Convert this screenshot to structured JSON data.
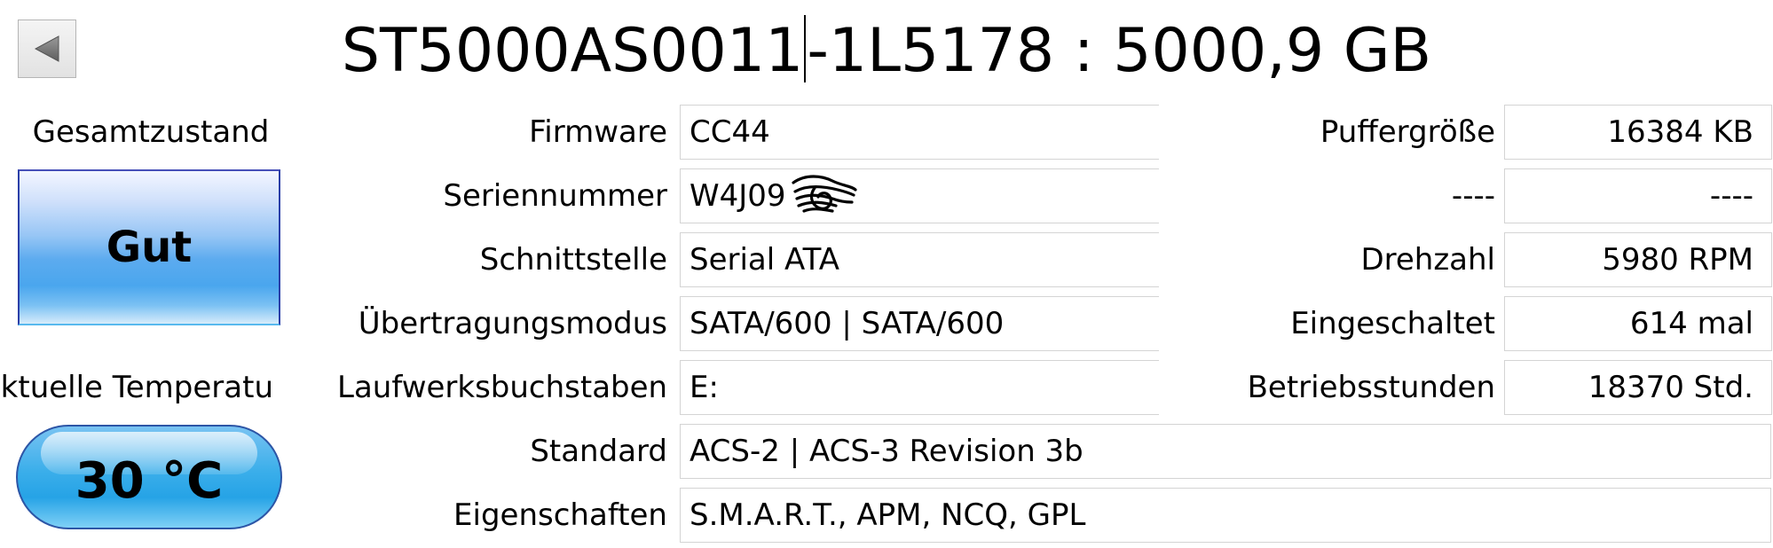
{
  "header": {
    "model_before_caret": "ST5000AS0011",
    "model_after_caret": "-1L5178 : 5000,9 GB"
  },
  "icons": {
    "back": "back-arrow-icon"
  },
  "health": {
    "label": "Gesamtzustand",
    "status": "Gut",
    "colors": {
      "top": "#f3f6ff",
      "mid": "#4aa6ee",
      "border": "#2b3fa8"
    }
  },
  "temperature": {
    "label": "ktuelle Temperatu",
    "value": "30 °C",
    "colors": {
      "fill": "#26a3e6",
      "border": "#2c55a6"
    }
  },
  "details": {
    "firmware": {
      "label": "Firmware",
      "value": "CC44"
    },
    "serial": {
      "label": "Seriennummer",
      "value": "W4J09"
    },
    "interface": {
      "label": "Schnittstelle",
      "value": "Serial ATA"
    },
    "transfer_mode": {
      "label": "Übertragungsmodus",
      "value": "SATA/600 | SATA/600"
    },
    "drive_letters": {
      "label": "Laufwerksbuchstaben",
      "value": "E:"
    },
    "standard": {
      "label": "Standard",
      "value": "ACS-2 | ACS-3 Revision 3b"
    },
    "features": {
      "label": "Eigenschaften",
      "value": "S.M.A.R.T., APM, NCQ, GPL"
    }
  },
  "right_details": {
    "buffer": {
      "label": "Puffergröße",
      "value": "16384 KB"
    },
    "unknown": {
      "label": "----",
      "value": "----"
    },
    "rotation": {
      "label": "Drehzahl",
      "value": "5980 RPM"
    },
    "power_on_count": {
      "label": "Eingeschaltet",
      "value": "614 mal"
    },
    "power_on_hours": {
      "label": "Betriebsstunden",
      "value": "18370 Std."
    }
  }
}
